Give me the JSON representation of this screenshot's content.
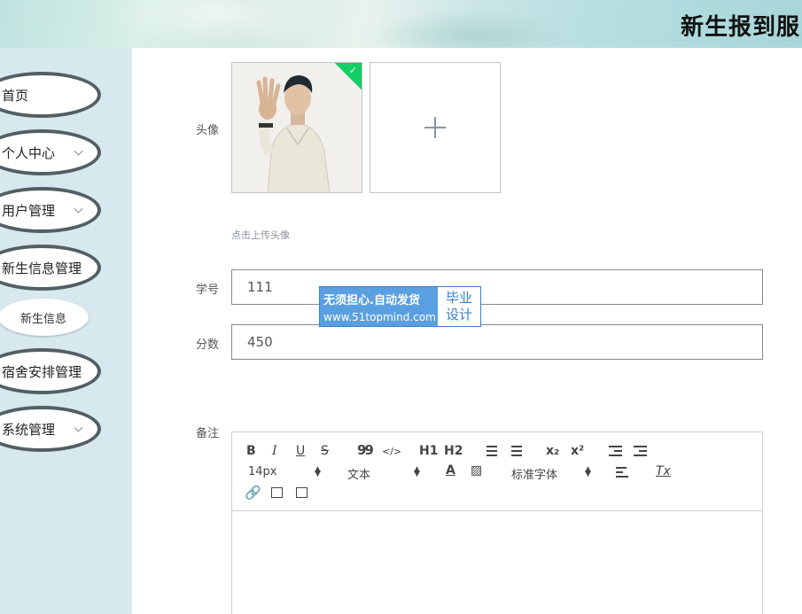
{
  "header": {
    "title": "新生报到服"
  },
  "sidebar": {
    "items": [
      {
        "label": "首页",
        "has_arrow": false
      },
      {
        "label": "个人中心",
        "has_arrow": true
      },
      {
        "label": "用户管理",
        "has_arrow": true
      },
      {
        "label": "新生信息管理",
        "has_arrow": false
      },
      {
        "label": "宿舍安排管理",
        "has_arrow": false
      },
      {
        "label": "系统管理",
        "has_arrow": true
      }
    ],
    "sub_items": [
      {
        "label": "新生信息"
      }
    ]
  },
  "form": {
    "avatar_label": "头像",
    "upload_hint": "点击上传头像",
    "student_id_label": "学号",
    "student_id_value": "111",
    "score_label": "分数",
    "score_value": "450",
    "remark_label": "备注"
  },
  "watermark": {
    "line1": "无须担心.自动发货",
    "line2": "www.51topmind.com",
    "right_top": "毕业",
    "right_bottom": "设计"
  },
  "editor": {
    "toolbar": {
      "bold": "B",
      "italic": "I",
      "underline": "U",
      "strike": "S",
      "quote": "99",
      "code": "</>",
      "h1": "H1",
      "h2": "H2",
      "subscript": "x₂",
      "superscript": "x²",
      "font_size": "14px",
      "header_select": "文本",
      "font_family": "标准字体",
      "clean": "Tx"
    }
  },
  "colors": {
    "sidebar_bg": "#d7e9ee",
    "menu_border": "#525f63",
    "success_green": "#13ce66",
    "watermark_blue": "#5a9fe0"
  }
}
